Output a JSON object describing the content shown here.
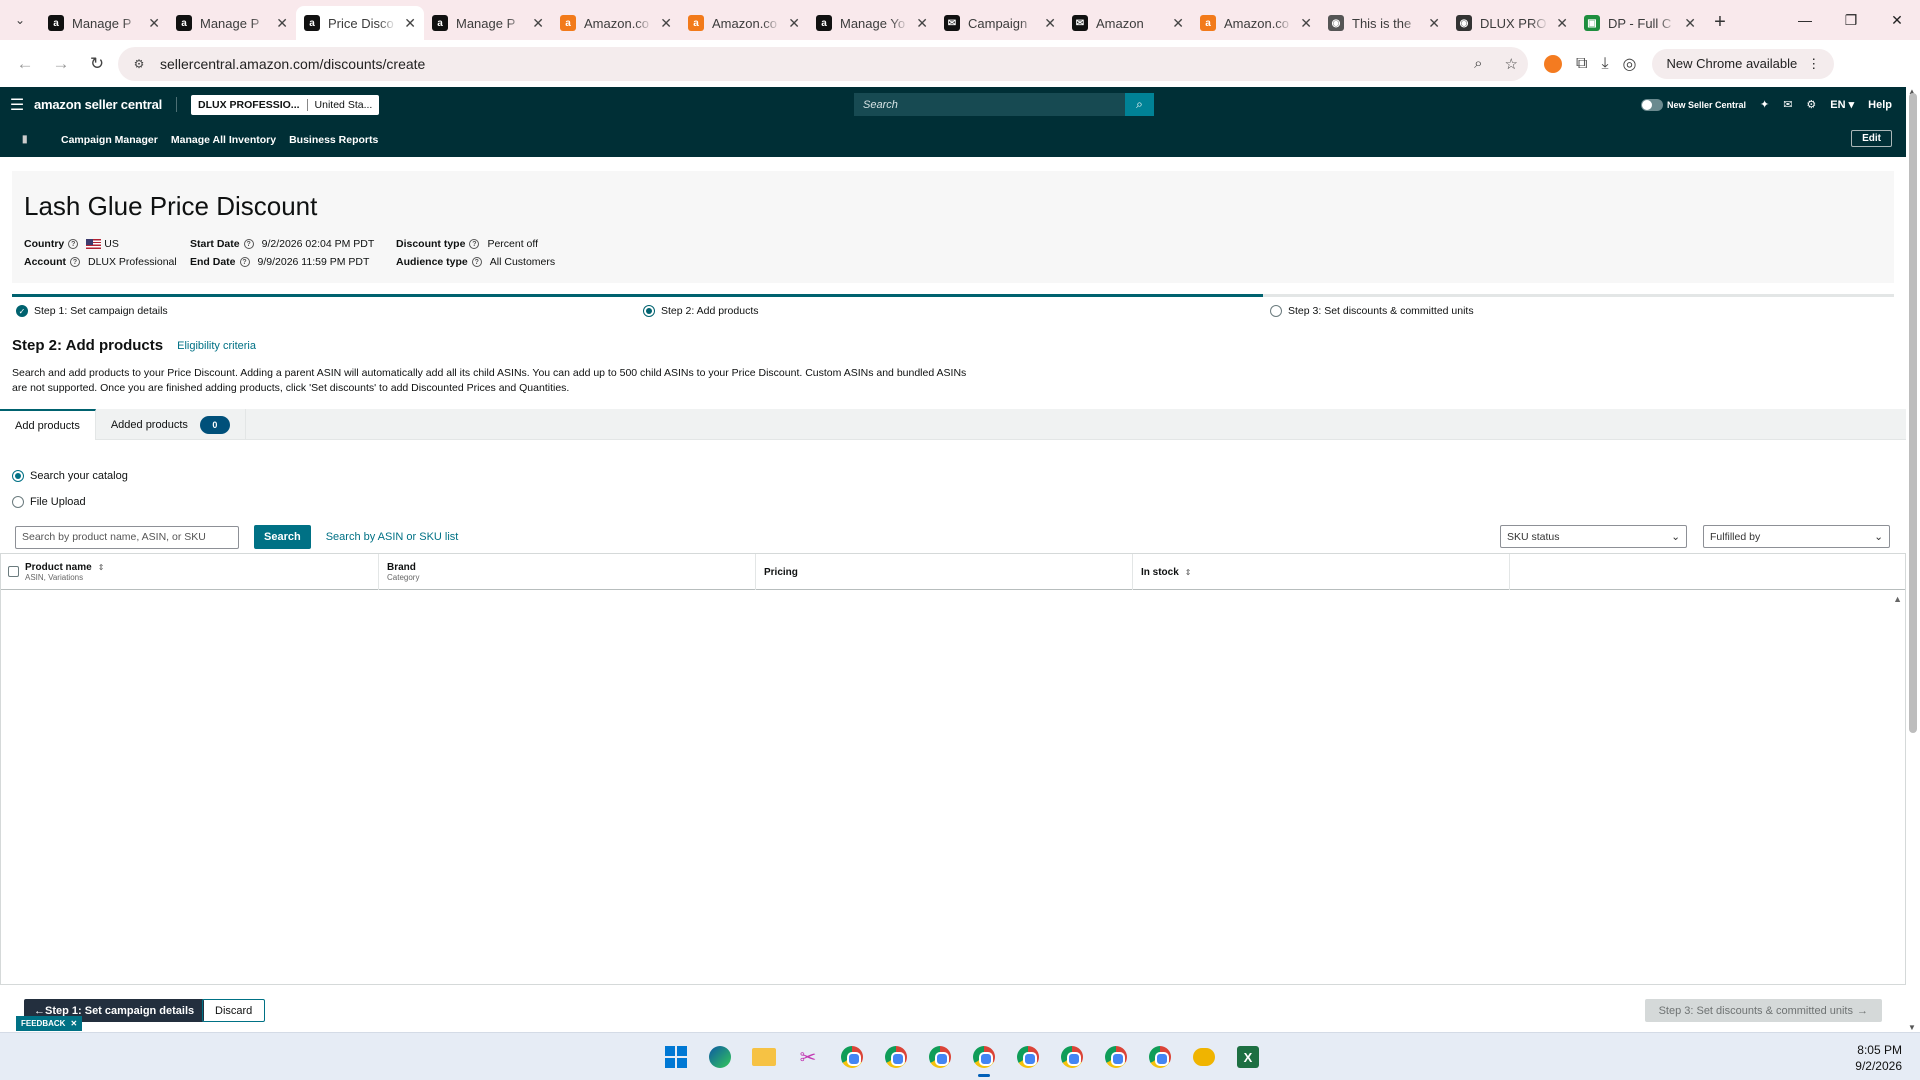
{
  "browser": {
    "tabs": [
      {
        "title": "Manage P",
        "fav": "a",
        "color": "#111"
      },
      {
        "title": "Manage P",
        "fav": "a",
        "color": "#111"
      },
      {
        "title": "Price Disco",
        "fav": "a",
        "color": "#111",
        "active": true
      },
      {
        "title": "Manage P",
        "fav": "a",
        "color": "#111"
      },
      {
        "title": "Amazon.co",
        "fav": "a",
        "color": "#f27a1a"
      },
      {
        "title": "Amazon.co",
        "fav": "a",
        "color": "#f27a1a"
      },
      {
        "title": "Manage Yo",
        "fav": "a",
        "color": "#111"
      },
      {
        "title": "Campaign",
        "fav": "✉",
        "color": "#111"
      },
      {
        "title": "Amazon",
        "fav": "✉",
        "color": "#111"
      },
      {
        "title": "Amazon.co",
        "fav": "a",
        "color": "#f27a1a"
      },
      {
        "title": "This is the",
        "fav": "◉",
        "color": "#555"
      },
      {
        "title": "DLUX PRO",
        "fav": "◉",
        "color": "#333"
      },
      {
        "title": "DP - Full C",
        "fav": "▣",
        "color": "#1e8e3e"
      }
    ],
    "url": "sellercentral.amazon.com/discounts/create",
    "new_chrome": "New Chrome available"
  },
  "header": {
    "logo": "amazon seller central",
    "account_name": "DLUX PROFESSIO...",
    "account_region": "United Sta...",
    "search_placeholder": "Search",
    "new_seller_central": "New Seller Central",
    "lang": "EN ▾",
    "help": "Help"
  },
  "nav": {
    "links": [
      "Campaign Manager",
      "Manage All Inventory",
      "Business Reports"
    ],
    "edit": "Edit"
  },
  "summary": {
    "title": "Lash Glue Price Discount",
    "country_label": "Country",
    "country_value": "US",
    "account_label": "Account",
    "account_value": "DLUX Professional",
    "start_label": "Start Date",
    "start_value": "9/2/2026 02:04 PM PDT",
    "end_label": "End Date",
    "end_value": "9/9/2026 11:59 PM PDT",
    "discount_label": "Discount type",
    "discount_value": "Percent off",
    "audience_label": "Audience type",
    "audience_value": "All Customers"
  },
  "steps": {
    "step1": "Step 1: Set campaign details",
    "step2": "Step 2: Add products",
    "step3": "Step 3: Set discounts & committed units"
  },
  "step2": {
    "heading": "Step 2: Add products",
    "eligibility": "Eligibility criteria",
    "description": "Search and add products to your Price Discount. Adding a parent ASIN will automatically add all its child ASINs. You can add up to 500 child ASINs to your Price Discount. Custom ASINs and bundled ASINs are not supported. Once you are finished adding products, click 'Set discounts' to add Discounted Prices and Quantities."
  },
  "tabs": {
    "add_products": "Add products",
    "added_products": "Added products",
    "added_count": "0"
  },
  "search": {
    "option_catalog": "Search your catalog",
    "option_upload": "File Upload",
    "placeholder": "Search by product name, ASIN, or SKU",
    "button": "Search",
    "asin_list": "Search by ASIN or SKU list",
    "sku_status": "SKU status",
    "fulfilled_by": "Fulfilled by"
  },
  "table": {
    "col_product": "Product name",
    "col_product_sub": "ASIN, Variations",
    "col_brand": "Brand",
    "col_brand_sub": "Category",
    "col_pricing": "Pricing",
    "col_stock": "In stock"
  },
  "footer": {
    "back": "Step 1: Set campaign details",
    "discard": "Discard",
    "next": "Step 3: Set discounts & committed units",
    "feedback": "FEEDBACK"
  },
  "clock": {
    "time": "8:05 PM",
    "date": "9/2/2026"
  }
}
